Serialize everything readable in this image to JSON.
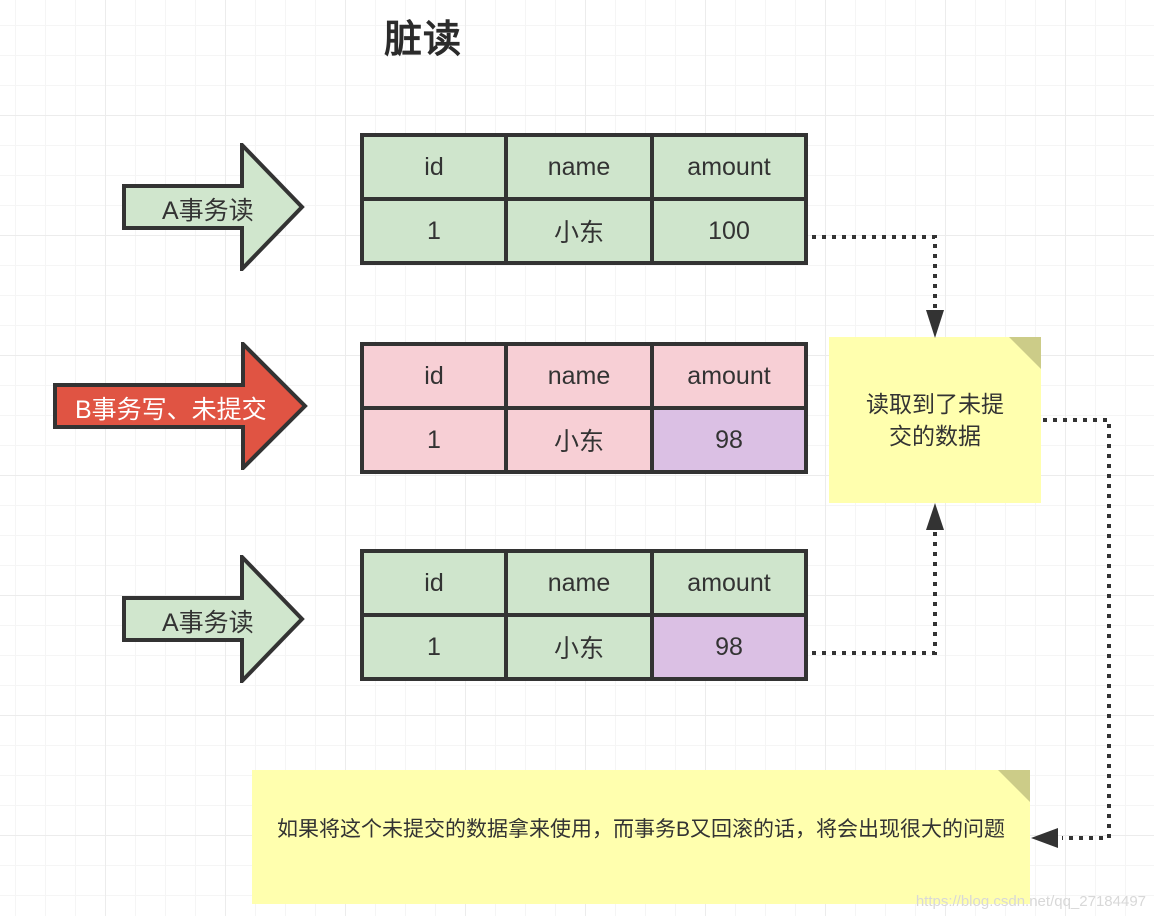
{
  "title": "脏读",
  "arrows": [
    {
      "label": "A事务读",
      "fill": "#d0e6cd",
      "text_color": "#333333"
    },
    {
      "label": "B事务写、未提交",
      "fill": "#e05443",
      "text_color": "#ffffff"
    },
    {
      "label": "A事务读",
      "fill": "#d0e6cd",
      "text_color": "#333333"
    }
  ],
  "tables": [
    {
      "headers": [
        "id",
        "name",
        "amount"
      ],
      "row": [
        "1",
        "小东",
        "100"
      ]
    },
    {
      "headers": [
        "id",
        "name",
        "amount"
      ],
      "row": [
        "1",
        "小东",
        "98"
      ]
    },
    {
      "headers": [
        "id",
        "name",
        "amount"
      ],
      "row": [
        "1",
        "小东",
        "98"
      ]
    }
  ],
  "notes": {
    "read_uncommitted": "读取到了未提交的数据",
    "consequence": "如果将这个未提交的数据拿来使用，而事务B又回滚的话，将会出现很大的问题"
  },
  "colors": {
    "green": "#cfe5cc",
    "pink": "#f7cfd5",
    "purple": "#dbc0e4",
    "red": "#e05443",
    "note": "#ffffae",
    "note_fold": "#cccc88"
  },
  "watermark": "https://blog.csdn.net/qq_27184497"
}
